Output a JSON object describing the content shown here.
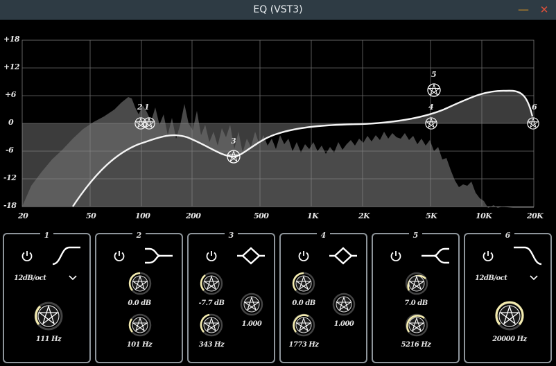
{
  "window": {
    "title": "EQ (VST3)",
    "minimize_label": "—",
    "close_label": "✕"
  },
  "graph": {
    "y_labels": [
      "+18",
      "+12",
      "+6",
      "0",
      "-6",
      "-12",
      "-18"
    ],
    "x_labels": [
      "20",
      "50",
      "100",
      "200",
      "500",
      "1K",
      "2K",
      "5K",
      "10K",
      "20K"
    ],
    "node_labels": [
      "2",
      "1",
      "3",
      "4",
      "5",
      "6"
    ],
    "accent": "#ffffff",
    "fill": "#7a7a7a"
  },
  "bands": [
    {
      "number": "1",
      "shape": "high-pass-icon",
      "slope": "12dB/oct",
      "freq": "111 Hz"
    },
    {
      "number": "2",
      "shape": "low-shelf-icon",
      "gain": "0.0 dB",
      "freq": "101 Hz"
    },
    {
      "number": "3",
      "shape": "bell-icon",
      "gain": "-7.7 dB",
      "q": "1.000",
      "freq": "343 Hz"
    },
    {
      "number": "4",
      "shape": "bell-icon",
      "gain": "0.0 dB",
      "q": "1.000",
      "freq": "1773 Hz"
    },
    {
      "number": "5",
      "shape": "high-shelf-icon",
      "gain": "7.0 dB",
      "freq": "5216 Hz"
    },
    {
      "number": "6",
      "shape": "low-pass-icon",
      "slope": "12dB/oct",
      "freq": "20000 Hz"
    }
  ]
}
